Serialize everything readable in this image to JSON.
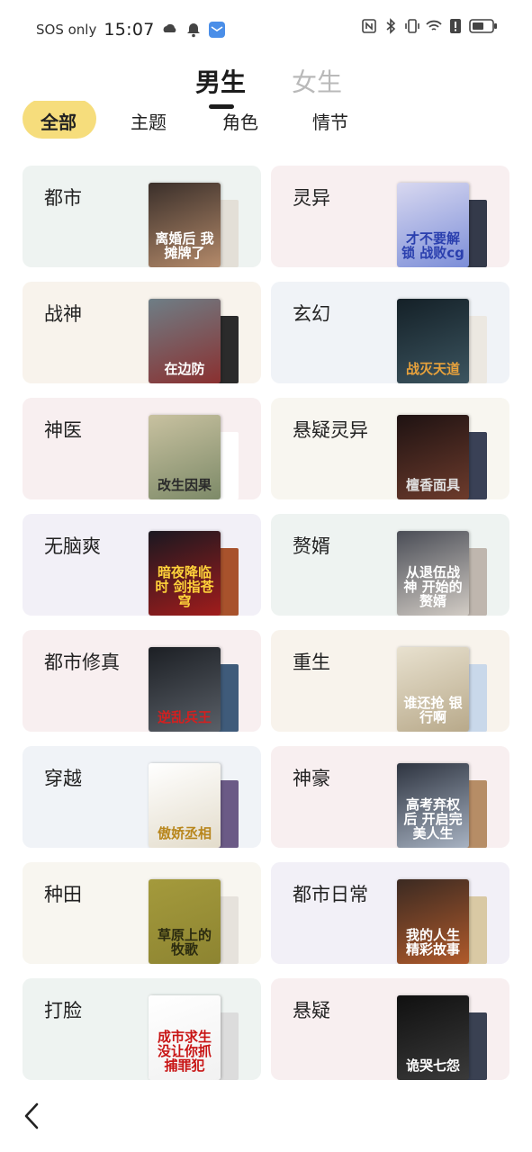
{
  "status_bar": {
    "carrier": "SOS only",
    "time": "15:07",
    "left_icons": [
      "cloud-app-icon",
      "bell-icon",
      "mail-app-icon"
    ],
    "right_icons": [
      "nfc-icon",
      "bluetooth-icon",
      "vibrate-icon",
      "wifi-icon",
      "alert-icon",
      "battery-icon"
    ]
  },
  "gender_tabs": {
    "male": "男生",
    "female": "女生",
    "selected": "男生"
  },
  "filter_tabs": {
    "all": "全部",
    "theme": "主题",
    "role": "角色",
    "plot": "情节",
    "selected": "全部"
  },
  "categories": [
    {
      "label": "都市",
      "bg": "#eef3f1",
      "cover": {
        "title": "离婚后 我摊牌了",
        "color1": "#3a2f2a",
        "color2": "#b48a6a",
        "text_color": "#ffffff",
        "back": "#e3dfd7"
      }
    },
    {
      "label": "灵异",
      "bg": "#f8eff0",
      "cover": {
        "title": "才不要解锁 战败cg",
        "color1": "#d8d8f0",
        "color2": "#7c8ed8",
        "text_color": "#2a3fae",
        "back": "#343a4a"
      }
    },
    {
      "label": "战神",
      "bg": "#f8f3ec",
      "cover": {
        "title": "在边防",
        "color1": "#6e7e86",
        "color2": "#8a3030",
        "text_color": "#ffffff",
        "back": "#2b2b2b"
      }
    },
    {
      "label": "玄幻",
      "bg": "#f0f3f7",
      "cover": {
        "title": "战灭天道",
        "color1": "#142027",
        "color2": "#3c5560",
        "text_color": "#e8a23c",
        "back": "#ece8e1"
      }
    },
    {
      "label": "神医",
      "bg": "#f8eff0",
      "cover": {
        "title": "改生因果",
        "color1": "#c8c1a0",
        "color2": "#7d8a68",
        "text_color": "#2b2b2b",
        "back": "#ffffff"
      }
    },
    {
      "label": "悬疑灵异",
      "bg": "#f8f6f0",
      "cover": {
        "title": "檀香面具",
        "color1": "#1e1212",
        "color2": "#6d3b2c",
        "text_color": "#e0e0e0",
        "back": "#3a4156"
      }
    },
    {
      "label": "无脑爽",
      "bg": "#f2f0f7",
      "cover": {
        "title": "暗夜降临时 剑指苍穹",
        "color1": "#1a1820",
        "color2": "#a11c1c",
        "text_color": "#ffd23a",
        "back": "#a8522c"
      }
    },
    {
      "label": "赘婿",
      "bg": "#eef3f1",
      "cover": {
        "title": "从退伍战神 开始的赘婿",
        "color1": "#4a4d56",
        "color2": "#d2ccc5",
        "text_color": "#ffffff",
        "back": "#bfb6ae"
      }
    },
    {
      "label": "都市修真",
      "bg": "#f8eff0",
      "cover": {
        "title": "逆乱兵王",
        "color1": "#1c1f24",
        "color2": "#5a6068",
        "text_color": "#d22020",
        "back": "#3f5b7a"
      }
    },
    {
      "label": "重生",
      "bg": "#f8f3ec",
      "cover": {
        "title": "谁还抢 银行啊",
        "color1": "#e8e1cf",
        "color2": "#b8a98a",
        "text_color": "#ffffff",
        "back": "#c9d8ea"
      }
    },
    {
      "label": "穿越",
      "bg": "#f0f3f7",
      "cover": {
        "title": "傲娇丞相",
        "color1": "#ffffff",
        "color2": "#e3dccb",
        "text_color": "#b8861c",
        "back": "#6b5a86"
      }
    },
    {
      "label": "神豪",
      "bg": "#f8eff0",
      "cover": {
        "title": "高考弃权后 开启完美人生",
        "color1": "#2e3440",
        "color2": "#a7b2c2",
        "text_color": "#ffffff",
        "back": "#b68d66"
      }
    },
    {
      "label": "种田",
      "bg": "#f8f6f0",
      "cover": {
        "title": "草原上的牧歌",
        "color1": "#a49a3c",
        "color2": "#8d8431",
        "text_color": "#2b2b10",
        "back": "#e6e2dc"
      }
    },
    {
      "label": "都市日常",
      "bg": "#f2f0f7",
      "cover": {
        "title": "我的人生 精彩故事",
        "color1": "#3b2a22",
        "color2": "#b05a2b",
        "text_color": "#ffffff",
        "back": "#d9c9a4"
      }
    },
    {
      "label": "打脸",
      "bg": "#eef3f1",
      "cover": {
        "title": "成市求生 没让你抓捕罪犯",
        "color1": "#ffffff",
        "color2": "#f1f1f1",
        "text_color": "#c81414",
        "back": "#dcdcdc"
      }
    },
    {
      "label": "悬疑",
      "bg": "#f8eff0",
      "cover": {
        "title": "诡哭七怨",
        "color1": "#101010",
        "color2": "#3a3a3a",
        "text_color": "#ffffff",
        "back": "#3a4152"
      }
    }
  ]
}
